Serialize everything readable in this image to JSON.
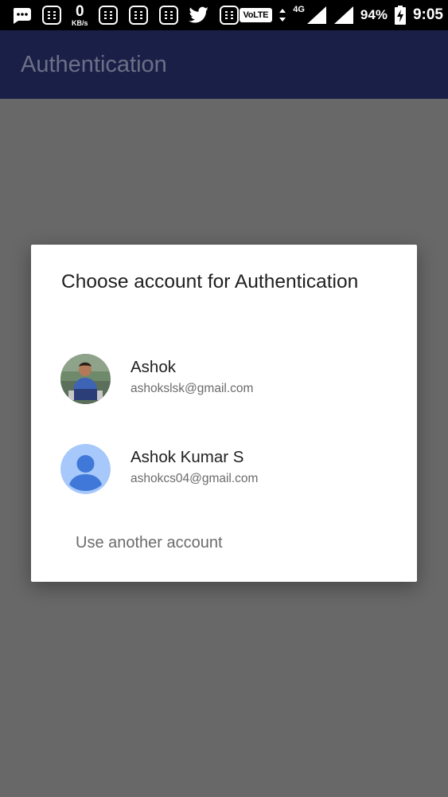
{
  "status_bar": {
    "speed_value": "0",
    "speed_unit": "KB/s",
    "volte": "VoLTE",
    "network": "4G",
    "battery": "94%",
    "time": "9:05",
    "icons": [
      "chat-icon",
      "grid-app-icon",
      "grid-app-icon",
      "grid-app-icon",
      "grid-app-icon",
      "twitter-icon",
      "grid-app-icon",
      "data-arrows-icon",
      "signal-icon",
      "signal-icon",
      "battery-charging-icon"
    ]
  },
  "app_bar": {
    "title": "Authentication"
  },
  "dialog": {
    "title": "Choose account for Authentication",
    "accounts": [
      {
        "name": "Ashok",
        "email": "ashokslsk@gmail.com",
        "avatar": "photo-avatar"
      },
      {
        "name": "Ashok Kumar S",
        "email": "ashokcs04@gmail.com",
        "avatar": "default-person-avatar"
      }
    ],
    "another_account_label": "Use another account"
  },
  "colors": {
    "app_bar": "#1a1f48",
    "scrim": "#686868",
    "default_avatar_bg": "#a6c8fa",
    "default_avatar_fg": "#3f78d8"
  }
}
